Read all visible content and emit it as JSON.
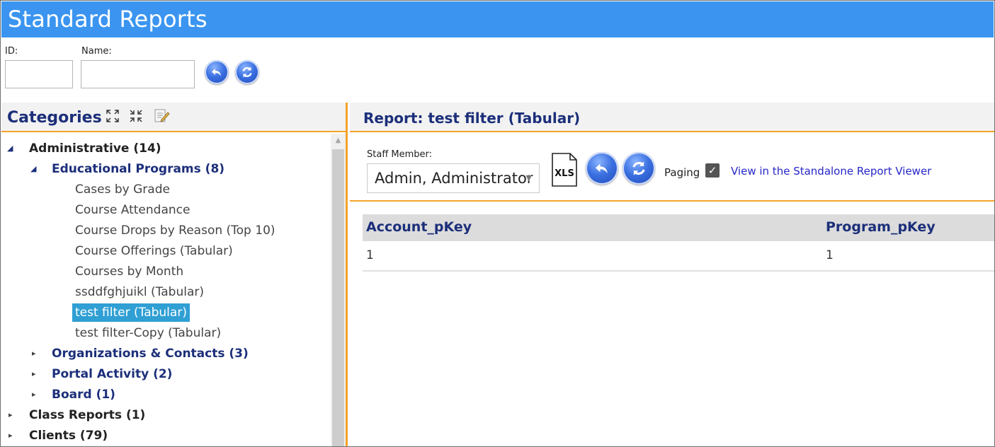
{
  "app": {
    "title": "Standard Reports"
  },
  "search": {
    "id_label": "ID:",
    "name_label": "Name:",
    "id_value": "",
    "name_value": ""
  },
  "categories": {
    "title": "Categories",
    "icons": [
      "expand-all-icon",
      "collapse-all-icon",
      "edit-list-icon"
    ],
    "tree": [
      {
        "label": "Administrative (14)",
        "level": 1,
        "expanded": true
      },
      {
        "label": "Educational Programs (8)",
        "level": 2,
        "expanded": true
      },
      {
        "label": "Cases by Grade",
        "level": 3
      },
      {
        "label": "Course Attendance",
        "level": 3
      },
      {
        "label": "Course Drops by Reason (Top 10)",
        "level": 3
      },
      {
        "label": "Course Offerings (Tabular)",
        "level": 3
      },
      {
        "label": "Courses by Month",
        "level": 3
      },
      {
        "label": "ssddfghjuikl (Tabular)",
        "level": 3
      },
      {
        "label": "test filter (Tabular)",
        "level": 3,
        "selected": true
      },
      {
        "label": "test filter-Copy (Tabular)",
        "level": 3
      },
      {
        "label": "Organizations & Contacts (3)",
        "level": 2,
        "expanded": false
      },
      {
        "label": "Portal Activity (2)",
        "level": 2,
        "expanded": false
      },
      {
        "label": "Board (1)",
        "level": 2,
        "expanded": false
      },
      {
        "label": "Class Reports (1)",
        "level": 1,
        "expanded": false
      },
      {
        "label": "Clients (79)",
        "level": 1,
        "expanded": false
      }
    ]
  },
  "report": {
    "title": "Report: test filter (Tabular)",
    "staff_label": "Staff Member:",
    "staff_value": "Admin, Administrator",
    "xls_label": "XLS",
    "paging_label": "Paging",
    "paging_checked": true,
    "paging_check_glyph": "✓",
    "standalone_link": "View in the Standalone Report Viewer",
    "columns": [
      "Account_pKey",
      "Program_pKey"
    ],
    "rows": [
      [
        "1",
        "1"
      ]
    ]
  },
  "colors": {
    "header_bg": "#3b95f0",
    "accent_orange": "#f4a32a",
    "title_navy": "#1c2f7a",
    "selected_bg": "#2f9fd4",
    "link_blue": "#2525c8"
  }
}
